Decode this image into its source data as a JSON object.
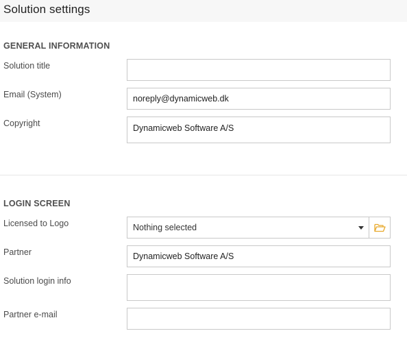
{
  "header": {
    "title": "Solution settings"
  },
  "general": {
    "section_title": "GENERAL INFORMATION",
    "solution_title": {
      "label": "Solution title",
      "value": ""
    },
    "email": {
      "label": "Email (System)",
      "value": "noreply@dynamicweb.dk"
    },
    "copyright": {
      "label": "Copyright",
      "value": "Dynamicweb Software A/S"
    }
  },
  "login": {
    "section_title": "LOGIN SCREEN",
    "licensed_logo": {
      "label": "Licensed to Logo",
      "value": "Nothing selected",
      "folder_icon": "folder-open-icon"
    },
    "partner": {
      "label": "Partner",
      "value": "Dynamicweb Software A/S"
    },
    "login_info": {
      "label": "Solution login info",
      "value": ""
    },
    "partner_email": {
      "label": "Partner e-mail",
      "value": ""
    }
  },
  "colors": {
    "header_bg": "#f7f7f7",
    "border": "#c8c8c8",
    "folder_icon": "#e8a92b"
  }
}
